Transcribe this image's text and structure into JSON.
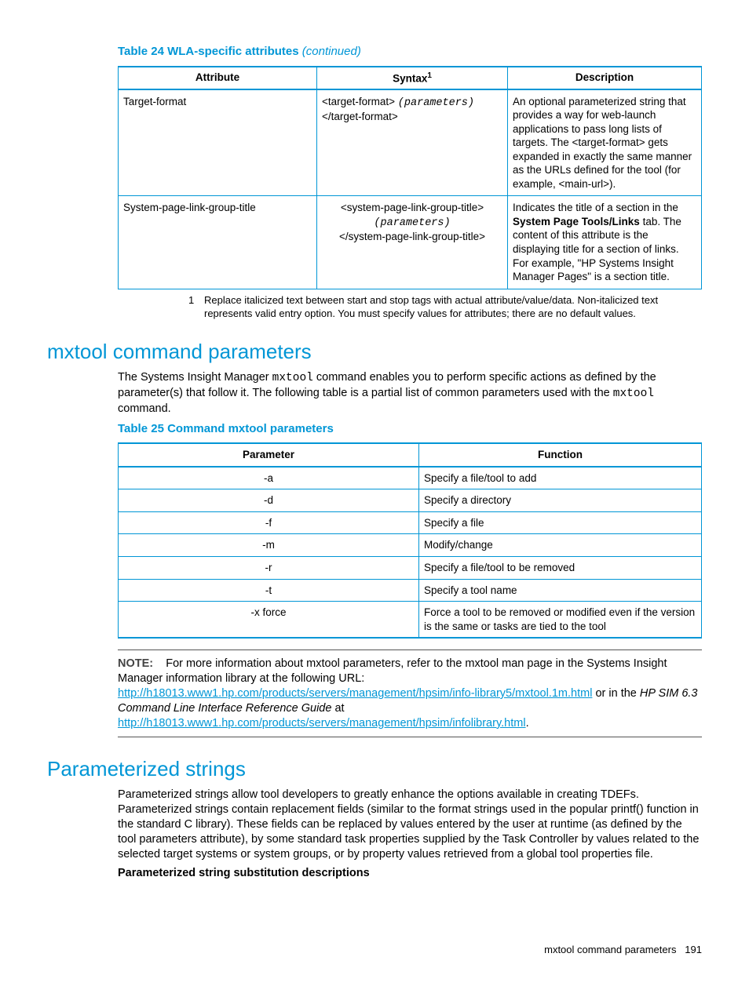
{
  "table24": {
    "caption": "Table 24 WLA-specific attributes",
    "cont": "(continued)",
    "headers": {
      "attr": "Attribute",
      "syntax": "Syntax",
      "sup": "1",
      "desc": "Description"
    },
    "row1": {
      "attr": "Target-format",
      "syn_l1a": "<target-format> ",
      "syn_l1b": "(parameters)",
      "syn_l2": "</target-format>",
      "desc": "An optional parameterized string that provides a way for web-launch applications to pass long lists of targets. The <target-format> gets expanded in exactly the same manner as the URLs defined for the tool (for example, <main-url>)."
    },
    "row2": {
      "attr": "System-page-link-group-title",
      "syn_l1": "<system-page-link-group-title>",
      "syn_l2": "(parameters)",
      "syn_l3": "</system-page-link-group-title>",
      "desc_a": "Indicates the title of a section in the ",
      "desc_bold": "System Page Tools/Links",
      "desc_b": " tab. The content of this attribute is the displaying title for a section of links. For example, \"HP Systems Insight Manager Pages\"  is a section title."
    },
    "footnote_num": "1",
    "footnote": "Replace italicized text between start and stop tags with actual attribute/value/data. Non-italicized text represents valid entry option. You must specify values for attributes; there are no default values."
  },
  "sec1": {
    "title": "mxtool command parameters",
    "p1a": "The Systems Insight Manager ",
    "p1m1": "mxtool",
    "p1b": " command enables you to perform specific actions as defined by the parameter(s) that follow it. The following table is a partial list of common parameters used with the ",
    "p1m2": "mxtool",
    "p1c": " command."
  },
  "table25": {
    "caption": "Table 25 Command mxtool parameters",
    "headers": {
      "param": "Parameter",
      "func": "Function"
    },
    "rows": {
      "r0": {
        "p": "-a",
        "f": "Specify a file/tool to add"
      },
      "r1": {
        "p": "-d",
        "f": "Specify a directory"
      },
      "r2": {
        "p": "-f",
        "f": "Specify a file"
      },
      "r3": {
        "p": "-m",
        "f": "Modify/change"
      },
      "r4": {
        "p": "-r",
        "f": "Specify a file/tool to be removed"
      },
      "r5": {
        "p": "-t",
        "f": "Specify a tool name"
      },
      "r6": {
        "p": "-x force",
        "f": "Force a tool to be removed or modified even if the version is the same or tasks are tied to the tool"
      }
    }
  },
  "note": {
    "label": "NOTE:",
    "t1": "For more information about mxtool parameters, refer to the mxtool man page in the Systems Insight Manager information library at the following URL: ",
    "link1": "http://h18013.www1.hp.com/products/servers/management/hpsim/info-library5/mxtool.1m.html",
    "t2": " or in the ",
    "ital": "HP SIM 6.3 Command Line Interface Reference Guide",
    "t3": " at ",
    "link2": "http://h18013.www1.hp.com/products/servers/management/hpsim/infolibrary.html",
    "t4": "."
  },
  "sec2": {
    "title": "Parameterized strings",
    "p1": "Parameterized strings allow tool developers to greatly enhance the options available in creating TDEFs. Parameterized strings contain replacement fields (similar to the format strings used in the popular printf() function in the standard C library). These fields can be replaced by values entered by the user at runtime (as defined by the tool parameters attribute), by some standard task properties supplied by the Task Controller by values related to the selected target systems or system groups, or by property values retrieved from a global tool properties file.",
    "sub": "Parameterized string substitution descriptions"
  },
  "footer": {
    "text": "mxtool command parameters",
    "page": "191"
  }
}
